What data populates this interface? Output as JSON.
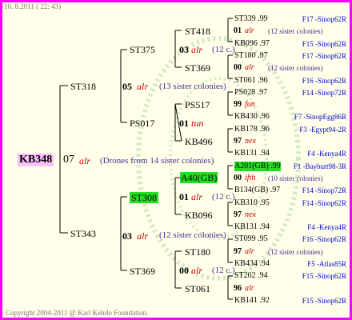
{
  "timestamp": "10.  8.2011 ( 22: 43)",
  "footer": "Copyright 2004-2011 @ Karl Kehrle Foundation.",
  "root": {
    "id": "KB348",
    "year": "07",
    "race": "alr",
    "note": "(Drones from 14 sister colonies)"
  },
  "gen1": [
    {
      "id": "ST318",
      "year": "05",
      "race": "alr",
      "note": "(13 sister colonies)"
    },
    {
      "id": "ST343",
      "year": "03",
      "race": "alr",
      "note": "(12 sister colonies)"
    }
  ],
  "gen2": [
    {
      "id": "ST375"
    },
    {
      "id": "PS017"
    },
    {
      "id": "ST308"
    },
    {
      "id": "ST369"
    }
  ],
  "gen3": [
    {
      "id": "ST418"
    },
    {
      "id": "ST369"
    },
    {
      "id": "PS517"
    },
    {
      "id": "KB496"
    },
    {
      "id": "A40(GB)"
    },
    {
      "id": "KB096"
    },
    {
      "id": "ST180"
    },
    {
      "id": "ST061"
    }
  ],
  "gen3_mid": [
    {
      "year": "03",
      "race": "alr",
      "note": "(12 c.)"
    },
    {
      "year": "01",
      "race": "tun",
      "note": ""
    },
    {
      "year": "01",
      "race": "alr",
      "note": "(12 c.)"
    },
    {
      "year": "00",
      "race": "alr",
      "note": "(12 c.)"
    }
  ],
  "gen4": [
    {
      "id": "ST339",
      "year": ".99",
      "origin": "F17 -Sinop62R",
      "highlight": false
    },
    {
      "id": "01",
      "year": "",
      "race": "alr",
      "note": "(12 sister colonies)",
      "type": "mid"
    },
    {
      "id": "KB096",
      "year": ".97",
      "origin": "F15 -Sinop62R",
      "highlight": false
    },
    {
      "id": "ST180",
      "year": ".97",
      "origin": "F17 -Sinop62R",
      "highlight": false
    },
    {
      "id": "00",
      "year": "",
      "race": "alr",
      "note": "(12 sister colonies)",
      "type": "mid"
    },
    {
      "id": "ST061",
      "year": ".96",
      "origin": "F16 -Sinop62R",
      "highlight": false
    },
    {
      "id": "PS028",
      "year": ".97",
      "origin": "F14 -Sinop72R",
      "highlight": false
    },
    {
      "id": "99",
      "year": "",
      "race": "fun",
      "note": "",
      "type": "mid"
    },
    {
      "id": "KB430",
      "year": ".96",
      "origin": "F7 -SinopEgg86R",
      "highlight": false
    },
    {
      "id": "KB178",
      "year": ".96",
      "origin": "F3 -Egypt94-2R",
      "highlight": false
    },
    {
      "id": "97",
      "year": "",
      "race": "nex",
      "note": "",
      "type": "mid"
    },
    {
      "id": "KB131",
      "year": ".94",
      "origin": "F4 -Kenya4R",
      "highlight": false
    },
    {
      "id": "A201(GB)",
      "year": ".99",
      "origin": "F1 -Bayburt98-3R",
      "highlight": true
    },
    {
      "id": "00",
      "year": "",
      "race": "ifth",
      "note": "(10 sister colonies)",
      "type": "mid"
    },
    {
      "id": "B134(GB)",
      "year": ".97",
      "origin": "F14 -Sinop72R",
      "highlight": false
    },
    {
      "id": "KB310",
      "year": ".95",
      "origin": "F14 -Sinop62R",
      "highlight": false
    },
    {
      "id": "97",
      "year": "",
      "race": "nex",
      "note": "",
      "type": "mid"
    },
    {
      "id": "KB131",
      "year": ".94",
      "origin": "F4 -Kenya4R",
      "highlight": false
    },
    {
      "id": "ST099",
      "year": ".95",
      "origin": "F16 -Sinop62R",
      "highlight": false
    },
    {
      "id": "97",
      "year": "",
      "race": "alr",
      "note": "(12 sister colonies)",
      "type": "mid"
    },
    {
      "id": "KB434",
      "year": ".94",
      "origin": "F5 -Atlas85R",
      "highlight": false
    },
    {
      "id": "ST202",
      "year": ".94",
      "origin": "F15 -Sinop62R",
      "highlight": false
    },
    {
      "id": "96",
      "year": "",
      "race": "alr",
      "note": "",
      "type": "mid"
    },
    {
      "id": "KB141",
      "year": ".92",
      "origin": "F15 -Sinop62R",
      "highlight": false
    }
  ]
}
